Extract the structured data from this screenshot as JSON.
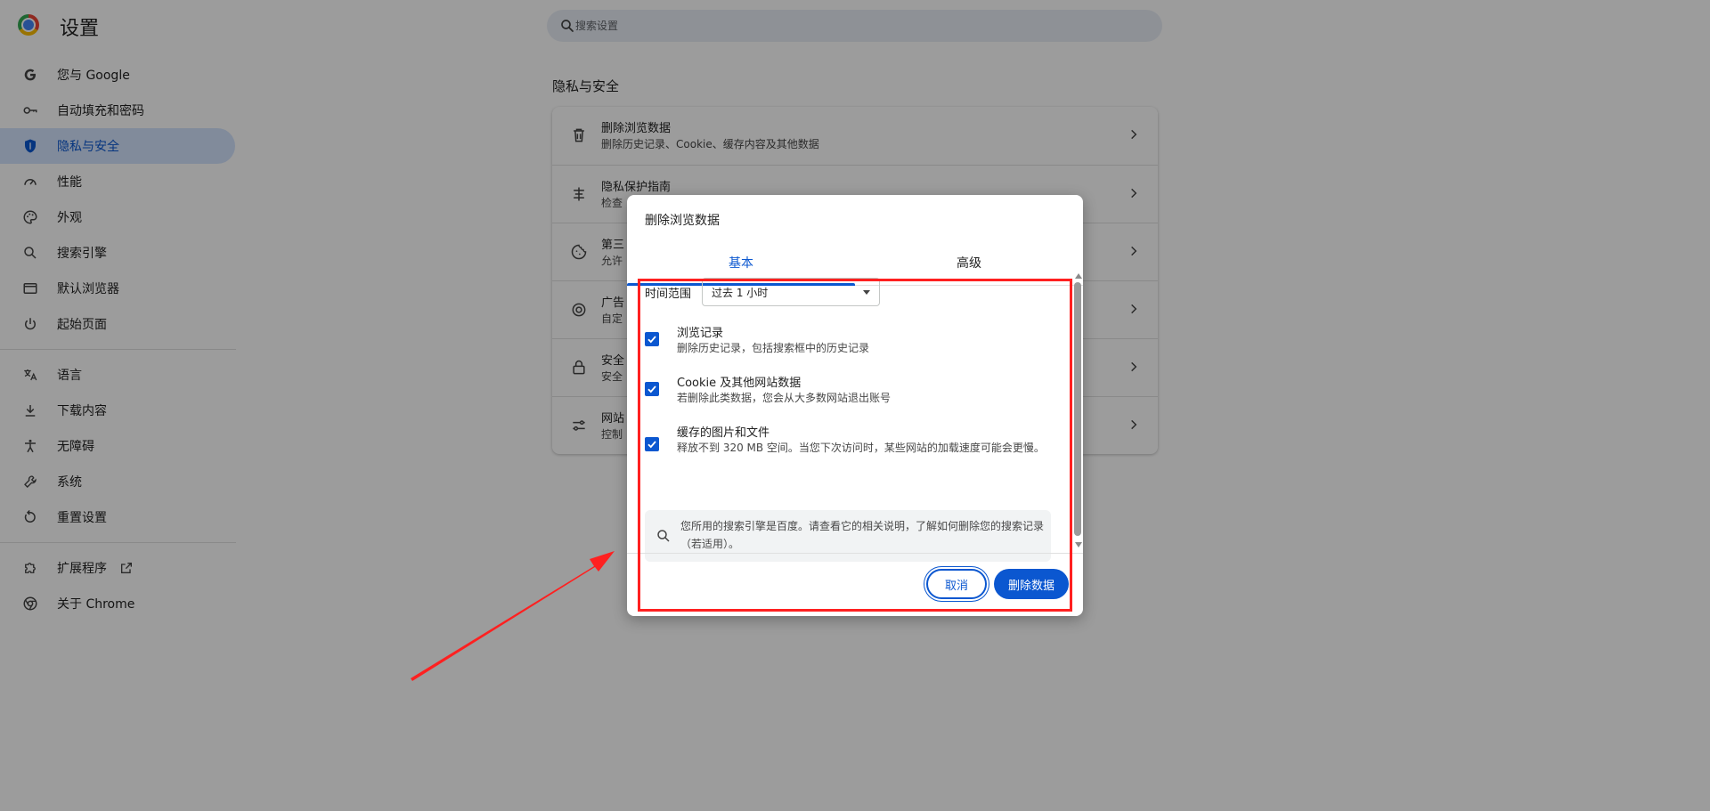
{
  "app": {
    "title": "设置"
  },
  "search": {
    "placeholder": "搜索设置"
  },
  "sidebar": {
    "items": [
      {
        "label": "您与 Google",
        "icon": "google-g-icon"
      },
      {
        "label": "自动填充和密码",
        "icon": "key-icon"
      },
      {
        "label": "隐私与安全",
        "icon": "shield-icon",
        "active": true
      },
      {
        "label": "性能",
        "icon": "speedometer-icon"
      },
      {
        "label": "外观",
        "icon": "palette-icon"
      },
      {
        "label": "搜索引擎",
        "icon": "search-icon"
      },
      {
        "label": "默认浏览器",
        "icon": "browser-window-icon"
      },
      {
        "label": "起始页面",
        "icon": "power-icon"
      },
      {
        "label": "语言",
        "icon": "translate-icon"
      },
      {
        "label": "下载内容",
        "icon": "download-icon"
      },
      {
        "label": "无障碍",
        "icon": "accessibility-icon"
      },
      {
        "label": "系统",
        "icon": "wrench-icon"
      },
      {
        "label": "重置设置",
        "icon": "reset-icon"
      },
      {
        "label": "扩展程序",
        "icon": "puzzle-icon"
      },
      {
        "label": "关于 Chrome",
        "icon": "chrome-icon"
      }
    ]
  },
  "main": {
    "section_title": "隐私与安全",
    "rows": [
      {
        "title": "删除浏览数据",
        "subtitle": "删除历史记录、Cookie、缓存内容及其他数据",
        "icon": "trash-icon"
      },
      {
        "title": "隐私保护指南",
        "subtitle": "检查",
        "icon": "guide-icon"
      },
      {
        "title": "第三",
        "subtitle": "允许",
        "icon": "cookie-icon"
      },
      {
        "title": "广告",
        "subtitle": "自定",
        "icon": "ad-privacy-icon"
      },
      {
        "title": "安全",
        "subtitle": "安全",
        "icon": "lock-icon"
      },
      {
        "title": "网站",
        "subtitle": "控制",
        "icon": "sliders-icon"
      }
    ]
  },
  "dialog": {
    "title": "删除浏览数据",
    "tabs": [
      "基本",
      "高级"
    ],
    "active_tab": "基本",
    "time_range_label": "时间范围",
    "time_range_value": "过去 1 小时",
    "options": [
      {
        "title": "浏览记录",
        "subtitle": "删除历史记录，包括搜索框中的历史记录",
        "checked": true
      },
      {
        "title": "Cookie 及其他网站数据",
        "subtitle": "若删除此类数据，您会从大多数网站退出账号",
        "checked": true
      },
      {
        "title": "缓存的图片和文件",
        "subtitle": "释放不到 320 MB 空间。当您下次访问时，某些网站的加载速度可能会更慢。",
        "checked": true
      }
    ],
    "info_text": "您所用的搜索引擎是百度。请查看它的相关说明，了解如何删除您的搜索记录（若适用）。",
    "cancel_label": "取消",
    "delete_label": "删除数据"
  },
  "colors": {
    "accent": "#0b57d0",
    "active_nav_bg": "#d3e3fd",
    "annotation_red": "#ff2020",
    "scrim": "rgba(0,0,0,0.39)"
  }
}
